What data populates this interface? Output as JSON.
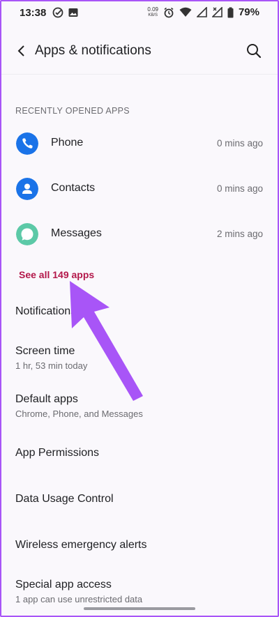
{
  "status_bar": {
    "time": "13:38",
    "net_speed_value": "0.09",
    "net_speed_unit": "KB/S",
    "battery": "79%"
  },
  "app_bar": {
    "title": "Apps & notifications"
  },
  "recent": {
    "header": "RECENTLY OPENED APPS",
    "apps": [
      {
        "name": "Phone",
        "time": "0 mins ago",
        "color": "#1a73e8"
      },
      {
        "name": "Contacts",
        "time": "0 mins ago",
        "color": "#1a73e8"
      },
      {
        "name": "Messages",
        "time": "2 mins ago",
        "color": "#5cc9a7"
      }
    ],
    "see_all": "See all 149 apps"
  },
  "settings": [
    {
      "title": "Notifications",
      "subtitle": ""
    },
    {
      "title": "Screen time",
      "subtitle": "1 hr, 53 min today"
    },
    {
      "title": "Default apps",
      "subtitle": "Chrome, Phone, and Messages"
    },
    {
      "title": "App Permissions",
      "subtitle": ""
    },
    {
      "title": "Data Usage Control",
      "subtitle": ""
    },
    {
      "title": "Wireless emergency alerts",
      "subtitle": ""
    },
    {
      "title": "Special app access",
      "subtitle": "1 app can use unrestricted data"
    }
  ],
  "colors": {
    "accent": "#b3184a",
    "annotation_arrow": "#a855f7"
  }
}
